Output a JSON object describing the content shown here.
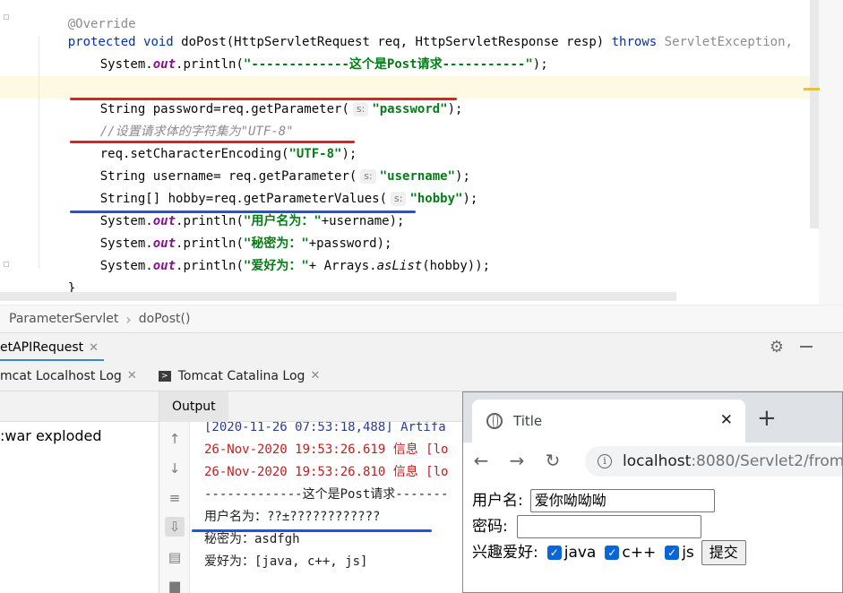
{
  "editor": {
    "lines": {
      "override": "@Override",
      "sig_protected": "protected",
      "sig_void": "void",
      "sig_name": "doPost(HttpServletRequest req, HttpServletResponse resp)",
      "sig_throws": "throws",
      "sig_exc": "ServletException,",
      "l1_a": "System.",
      "l1_out": "out",
      "l1_b": ".println(",
      "l1_str": "\"-------------这个是Post请求-----------\"",
      "l1_c": ");",
      "l2_a": "String password=req.getParameter(",
      "l2_hint": "s:",
      "l2_str": "\"password\"",
      "l2_c": ");",
      "l3_cmt": "//设置请求体的字符集为\"UTF-8\"",
      "l4_a": "req.setCharacterEncoding(",
      "l4_str": "\"UTF-8\"",
      "l4_c": ");",
      "l5_a": "String username= req.getParameter(",
      "l5_hint": "s:",
      "l5_str": "\"username\"",
      "l5_c": ");",
      "l6_a": "String[] hobby=req.getParameterValues(",
      "l6_hint": "s:",
      "l6_str": "\"hobby\"",
      "l6_c": ");",
      "l7_a": "System.",
      "l7_out": "out",
      "l7_b": ".println(",
      "l7_str": "\"用户名为：\"",
      "l7_c": "+username);",
      "l8_a": "System.",
      "l8_out": "out",
      "l8_b": ".println(",
      "l8_str": "\"秘密为：\"",
      "l8_c": "+password);",
      "l9_a": "System.",
      "l9_out": "out",
      "l9_b": ".println(",
      "l9_str": "\"爱好为：\"",
      "l9_c": "+ Arrays.",
      "l9_aslist": "asList",
      "l9_d": "(hobby));",
      "close1": "}",
      "close2": "}"
    },
    "colors": {
      "red_underline": "#e02020",
      "blue_underline": "#1a56e0"
    }
  },
  "breadcrumb": {
    "class": "ParameterServlet",
    "method": "doPost()"
  },
  "services": {
    "run_tab": "etAPIRequest",
    "log_tabs": [
      "mcat Localhost Log",
      "Tomcat Catalina Log"
    ],
    "deployment": ":war exploded",
    "output_tab": "Output"
  },
  "console": {
    "lines": [
      {
        "text": "[2020-11-26 07:53:18,488] Artifa",
        "color": "blue"
      },
      {
        "text": "26-Nov-2020 19:53:26.619 信息 [lo",
        "color": "red"
      },
      {
        "text": "26-Nov-2020 19:53:26.810 信息 [lo",
        "color": "red"
      },
      {
        "text": "-------------这个是Post请求-------",
        "color": "black"
      },
      {
        "text": "用户名为：??±????????????",
        "color": "black"
      },
      {
        "text": "秘密为：asdfgh",
        "color": "black"
      },
      {
        "text": "爱好为：[java, c++, js]",
        "color": "black"
      }
    ]
  },
  "browser": {
    "tab_title": "Title",
    "url_host": "localhost",
    "url_rest": ":8080/Servlet2/from.",
    "form": {
      "username_label": "用户名:",
      "username_value": "爱你呦呦呦",
      "password_label": "密码:",
      "password_value": "",
      "hobby_label": "兴趣爱好:",
      "options": [
        "java",
        "c++",
        "js"
      ],
      "submit_label": "提交"
    }
  }
}
